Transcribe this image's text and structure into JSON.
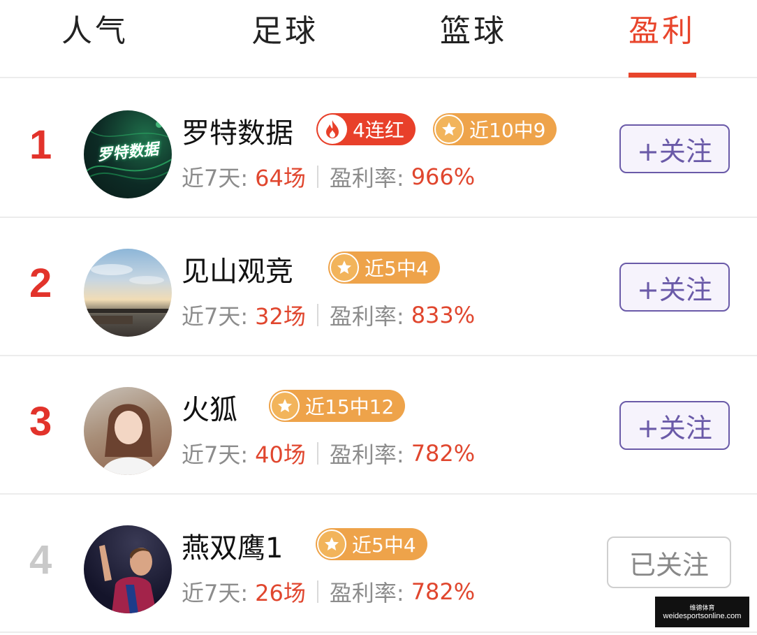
{
  "tabs": [
    {
      "label": "人气",
      "active": false
    },
    {
      "label": "足球",
      "active": false
    },
    {
      "label": "篮球",
      "active": false
    },
    {
      "label": "盈利",
      "active": true
    }
  ],
  "accent_color": "#e8452c",
  "rows": [
    {
      "rank": "1",
      "name": "罗特数据",
      "avatar_text": "罗特数据",
      "badges": [
        {
          "type": "red",
          "icon": "fire-icon",
          "text": "4连红"
        },
        {
          "type": "gold",
          "icon": "star-icon",
          "text": "近10中9"
        }
      ],
      "stats": {
        "days_label": "近7天:",
        "days_value": "64场",
        "rate_label": "盈利率:",
        "rate_value": "966%"
      },
      "follow_label": "+关注"
    },
    {
      "rank": "2",
      "name": "见山观竞",
      "badges": [
        {
          "type": "gold",
          "icon": "star-icon",
          "text": "近5中4"
        }
      ],
      "stats": {
        "days_label": "近7天:",
        "days_value": "32场",
        "rate_label": "盈利率:",
        "rate_value": "833%"
      },
      "follow_label": "+关注"
    },
    {
      "rank": "3",
      "name": "火狐",
      "badges": [
        {
          "type": "gold",
          "icon": "star-icon",
          "text": "近15中12"
        }
      ],
      "stats": {
        "days_label": "近7天:",
        "days_value": "40场",
        "rate_label": "盈利率:",
        "rate_value": "782%"
      },
      "follow_label": "+关注"
    },
    {
      "rank": "4",
      "name": "燕双鹰1",
      "badges": [
        {
          "type": "gold",
          "icon": "star-icon",
          "text": "近5中4"
        }
      ],
      "stats": {
        "days_label": "近7天:",
        "days_value": "26场",
        "rate_label": "盈利率:",
        "rate_value": "782%"
      },
      "follow_label": "已关注"
    }
  ],
  "watermark": {
    "line1": "维德体育",
    "line2": "weidesportsonline.com"
  }
}
